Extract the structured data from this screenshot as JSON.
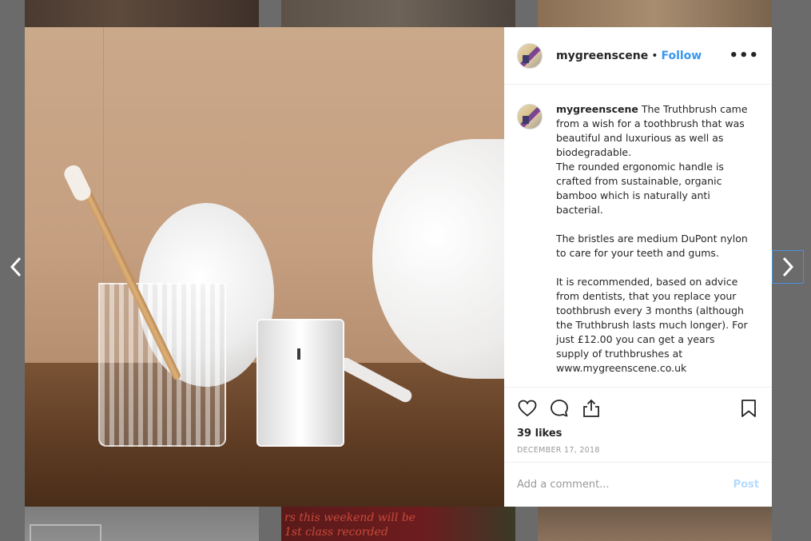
{
  "background_grid": {
    "promo_line_1": "rs this weekend will be",
    "promo_line_2": "1st class recorded"
  },
  "post": {
    "author": {
      "username": "mygreenscene",
      "separator": "•",
      "follow_label": "Follow",
      "more_label": "•••"
    },
    "caption": {
      "username": "mygreenscene",
      "text": " The Truthbrush came from a wish for a toothbrush that was beautiful and luxurious as well as biodegradable.\nThe rounded ergonomic handle is crafted from sustainable, organic bamboo which is naturally anti bacterial.\n\nThe bristles are medium DuPont nylon to care for your teeth and gums.\n\nIt is recommended, based on advice from dentists, that you replace your toothbrush every 3 months (although the Truthbrush lasts much longer). For just £12.00 you can get a years supply of truthbrushes at\nwww.mygreenscene.co.uk"
    },
    "likes_text": "39 likes",
    "date_text": "DECEMBER 17, 2018",
    "comment_box": {
      "placeholder": "Add a comment...",
      "value": "",
      "post_label": "Post"
    }
  },
  "icons": {
    "prev": "chevron-left-icon",
    "next": "chevron-right-icon",
    "like": "heart-icon",
    "comment": "comment-bubble-icon",
    "share": "share-icon",
    "save": "bookmark-icon",
    "more": "more-dots-icon"
  },
  "colors": {
    "accent": "#3897f0",
    "post_disabled": "#b3dbff",
    "muted_text": "#999999",
    "overlay": "#6b6b6b"
  }
}
